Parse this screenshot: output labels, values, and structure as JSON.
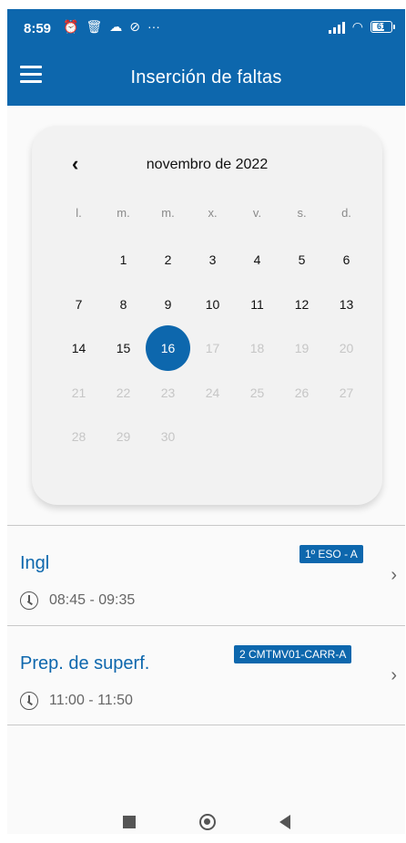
{
  "status": {
    "time": "8:59",
    "battery": "61",
    "overflow": "···"
  },
  "appbar": {
    "title": "Inserción de faltas"
  },
  "calendar": {
    "month_label": "novembro de 2022",
    "weekdays": [
      "l.",
      "m.",
      "m.",
      "x.",
      "v.",
      "s.",
      "d."
    ],
    "weeks": [
      [
        "",
        "1",
        "2",
        "3",
        "4",
        "5",
        "6"
      ],
      [
        "7",
        "8",
        "9",
        "10",
        "11",
        "12",
        "13"
      ],
      [
        "14",
        "15",
        "16",
        "17",
        "18",
        "19",
        "20"
      ],
      [
        "21",
        "22",
        "23",
        "24",
        "25",
        "26",
        "27"
      ],
      [
        "28",
        "29",
        "30",
        "",
        "",
        "",
        ""
      ]
    ],
    "selected_day": "16",
    "last_enabled_day": 16
  },
  "classes": [
    {
      "name": "Ingl",
      "group": "1º ESO - A",
      "time": "08:45 - 09:35"
    },
    {
      "name": "Prep. de superf.",
      "group": "2 CMTMV01-CARR-A",
      "time": "11:00 - 11:50"
    }
  ],
  "colors": {
    "primary": "#0d67ad",
    "disabled_text": "#c6c6c6"
  }
}
